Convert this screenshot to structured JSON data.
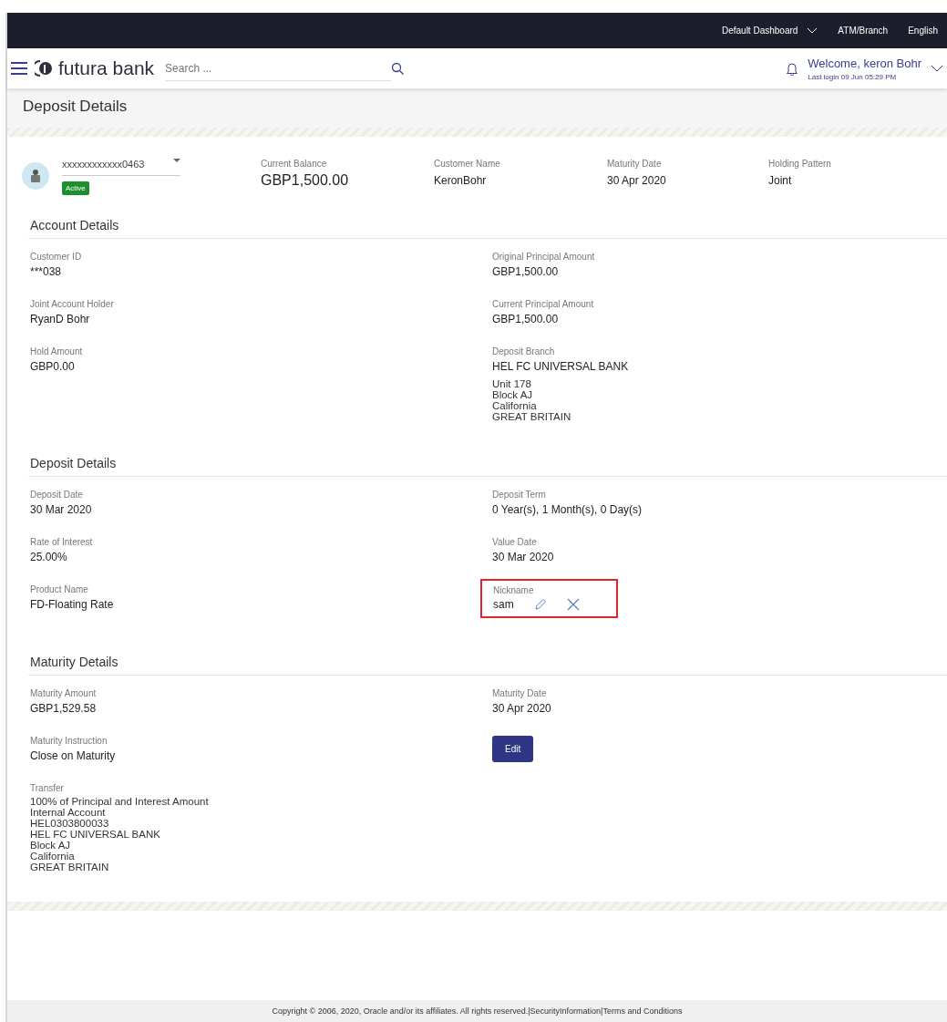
{
  "top_bar": {
    "items": [
      {
        "label": "Default Dashboard",
        "dropdown": true
      },
      {
        "label": "ATM/Branch",
        "dropdown": false
      },
      {
        "label": "English",
        "dropdown": false
      }
    ]
  },
  "header": {
    "logo": "futura bank",
    "search": {
      "placeholder": "Search ..."
    },
    "welcome": "Welcome, keron Bohr",
    "last_login": "Last login 09 Jun 05:29 PM"
  },
  "page_title": "Deposit Details",
  "summary": {
    "account": "xxxxxxxxxxxx0463",
    "status": "Active",
    "fields": [
      {
        "label": "Current Balance",
        "value": "GBP1,500.00",
        "large": true
      },
      {
        "label": "Customer Name",
        "value": "KeronBohr",
        "large": false
      },
      {
        "label": "Maturity Date",
        "value": "30 Apr 2020",
        "large": false
      },
      {
        "label": "Holding Pattern",
        "value": "Joint",
        "large": false
      }
    ]
  },
  "sections": [
    {
      "title": "Account Details",
      "left": [
        {
          "kind": "field",
          "label": "Customer ID",
          "value": "***038"
        },
        {
          "kind": "field",
          "label": "Joint Account Holder",
          "value": "RyanD Bohr"
        },
        {
          "kind": "field",
          "label": "Hold Amount",
          "value": "GBP0.00"
        }
      ],
      "right": [
        {
          "kind": "field",
          "label": "Original Principal Amount",
          "value": "GBP1,500.00"
        },
        {
          "kind": "field",
          "label": "Current Principal Amount",
          "value": "GBP1,500.00"
        },
        {
          "kind": "field",
          "label": "Deposit Branch",
          "value": "HEL FC UNIVERSAL BANK",
          "lines": [
            "Unit 178",
            "Block AJ",
            "California",
            "GREAT BRITAIN"
          ]
        }
      ]
    },
    {
      "title": "Deposit Details",
      "left": [
        {
          "kind": "field",
          "label": "Deposit Date",
          "value": "30 Mar 2020"
        },
        {
          "kind": "field",
          "label": "Rate of Interest",
          "value": "25.00%"
        },
        {
          "kind": "field",
          "label": "Product Name",
          "value": "FD-Floating Rate"
        }
      ],
      "right": [
        {
          "kind": "field",
          "label": "Deposit Term",
          "value": "0 Year(s), 1 Month(s), 0 Day(s)"
        },
        {
          "kind": "field",
          "label": "Value Date",
          "value": "30 Mar 2020"
        },
        {
          "kind": "nickname",
          "label": "Nickname",
          "value": "sam",
          "highlighted": true
        }
      ]
    },
    {
      "title": "Maturity Details",
      "left": [
        {
          "kind": "field",
          "label": "Maturity Amount",
          "value": "GBP1,529.58"
        },
        {
          "kind": "field",
          "label": "Maturity Instruction",
          "value": "Close on Maturity"
        },
        {
          "kind": "lines",
          "label": "Transfer",
          "lines": [
            "100% of Principal and Interest Amount",
            "Internal Account",
            "HEL0303800033",
            "HEL FC UNIVERSAL BANK",
            "Block AJ",
            "California",
            "GREAT BRITAIN"
          ]
        }
      ],
      "right": [
        {
          "kind": "field",
          "label": "Maturity Date",
          "value": "30 Apr 2020"
        },
        {
          "kind": "button",
          "label": "Edit"
        }
      ]
    }
  ],
  "footer": {
    "copyright": "Copyright © 2006, 2020, Oracle and/or its affiliates. All rights reserved.|SecurityInformation|Terms and Conditions"
  }
}
